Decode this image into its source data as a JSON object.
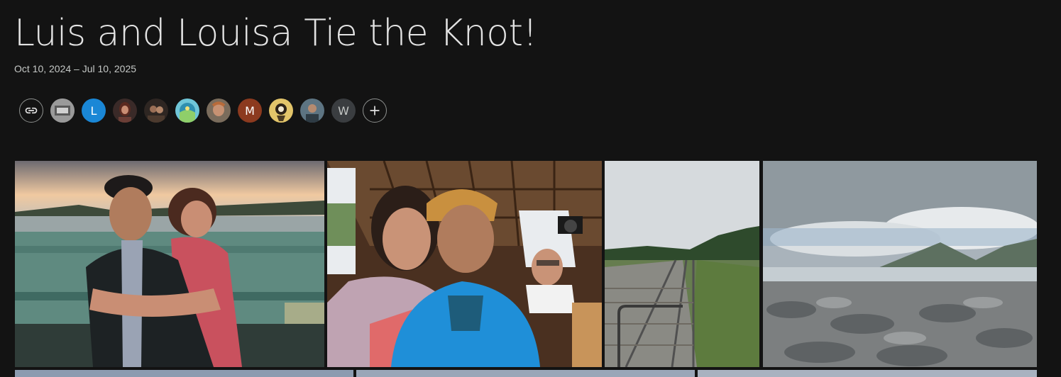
{
  "album": {
    "title": "Luis and Louisa Tie the Knot!",
    "date_range": "Oct 10, 2024 – Jul 10, 2025"
  },
  "sharing": {
    "link_icon": "link-icon",
    "add_icon": "plus-icon",
    "avatars": [
      {
        "kind": "photo",
        "name": "avatar-1",
        "color": "#8a8a8a"
      },
      {
        "kind": "letter",
        "letter": "L",
        "color": "#1a87d6"
      },
      {
        "kind": "photo",
        "name": "avatar-3",
        "color": "#6b3e36"
      },
      {
        "kind": "photo",
        "name": "avatar-4",
        "color": "#4c3a2e"
      },
      {
        "kind": "photo",
        "name": "avatar-5",
        "color": "#58b6c8"
      },
      {
        "kind": "photo",
        "name": "avatar-6",
        "color": "#8f7a64"
      },
      {
        "kind": "letter",
        "letter": "M",
        "color": "#8c3a1f"
      },
      {
        "kind": "photo",
        "name": "avatar-8",
        "color": "#c9a243"
      },
      {
        "kind": "photo",
        "name": "avatar-9",
        "color": "#4f6470"
      },
      {
        "kind": "letter",
        "letter": "W",
        "color": "#3a3d40"
      }
    ]
  },
  "photos": [
    {
      "name": "photo-couple-sunset",
      "color": "#5f8a80"
    },
    {
      "name": "photo-train-selfie",
      "color": "#5a3a26"
    },
    {
      "name": "photo-cog-railway-track",
      "color": "#667d4f"
    },
    {
      "name": "photo-mountain-summit",
      "color": "#7c7f80"
    },
    {
      "name": "photo-row2-a",
      "color": "#8c9bb0"
    },
    {
      "name": "photo-row2-b",
      "color": "#9aa6b8"
    },
    {
      "name": "photo-row2-c",
      "color": "#a8b2c0"
    }
  ]
}
